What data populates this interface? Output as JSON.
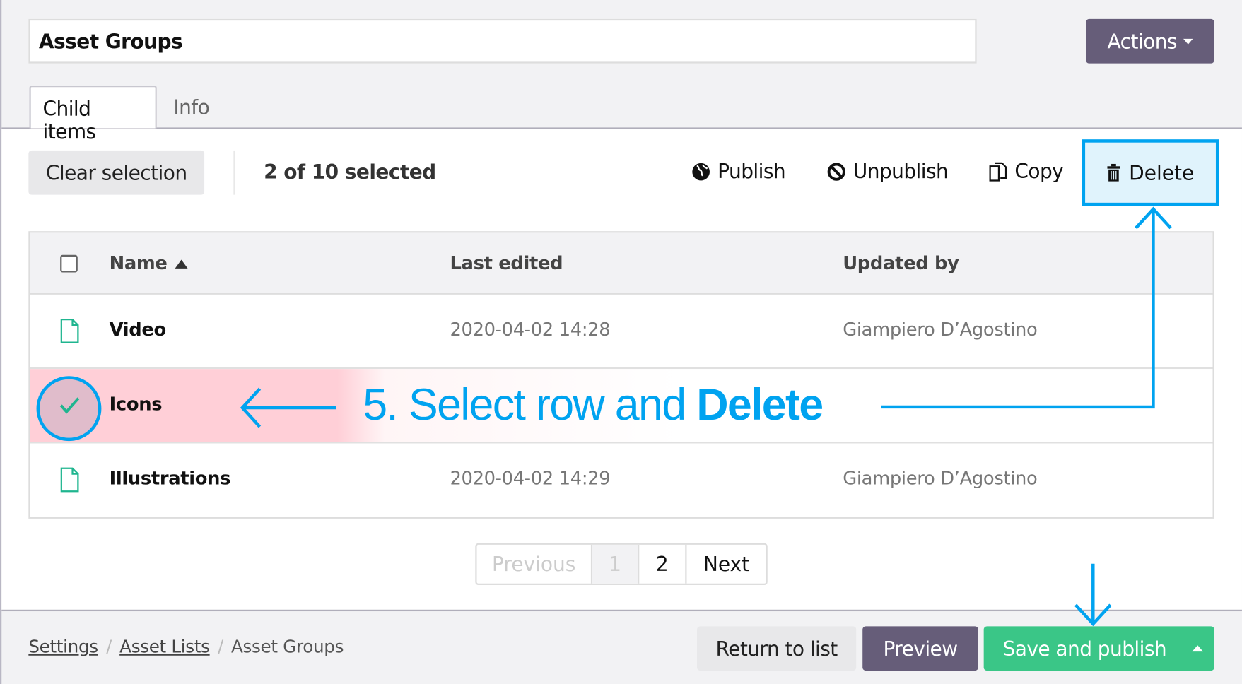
{
  "header": {
    "title": "Asset Groups",
    "actions_label": "Actions"
  },
  "tabs": [
    {
      "label": "Child items",
      "active": true
    },
    {
      "label": "Info",
      "active": false
    }
  ],
  "toolbar": {
    "clear_selection": "Clear selection",
    "selection_count": "2 of 10 selected",
    "publish": "Publish",
    "unpublish": "Unpublish",
    "copy": "Copy",
    "delete": "Delete"
  },
  "table": {
    "columns": [
      "Name",
      "Last edited",
      "Updated by"
    ],
    "sort": {
      "column": "Name",
      "direction": "ascending"
    },
    "rows": [
      {
        "name": "Video",
        "last_edited": "2020-04-02 14:28",
        "updated_by": "Giampiero D’Agostino",
        "selected": false
      },
      {
        "name": "Icons",
        "last_edited": "",
        "updated_by": "",
        "selected": true
      },
      {
        "name": "Illustrations",
        "last_edited": "2020-04-02 14:29",
        "updated_by": "Giampiero D’Agostino",
        "selected": false
      }
    ]
  },
  "annotation": {
    "prefix": "5. Select row and ",
    "emphasis": "Delete",
    "color": "#00a3f0"
  },
  "pagination": {
    "previous": "Previous",
    "pages": [
      "1",
      "2"
    ],
    "current": "1",
    "next": "Next"
  },
  "footer": {
    "breadcrumbs": [
      "Settings",
      "Asset Lists",
      "Asset Groups"
    ],
    "return_label": "Return to list",
    "preview_label": "Preview",
    "save_label": "Save and publish"
  },
  "colors": {
    "primary": "#665d79",
    "success": "#3ac687",
    "highlight": "#00a3f0",
    "file_icon": "#1fb58f"
  }
}
